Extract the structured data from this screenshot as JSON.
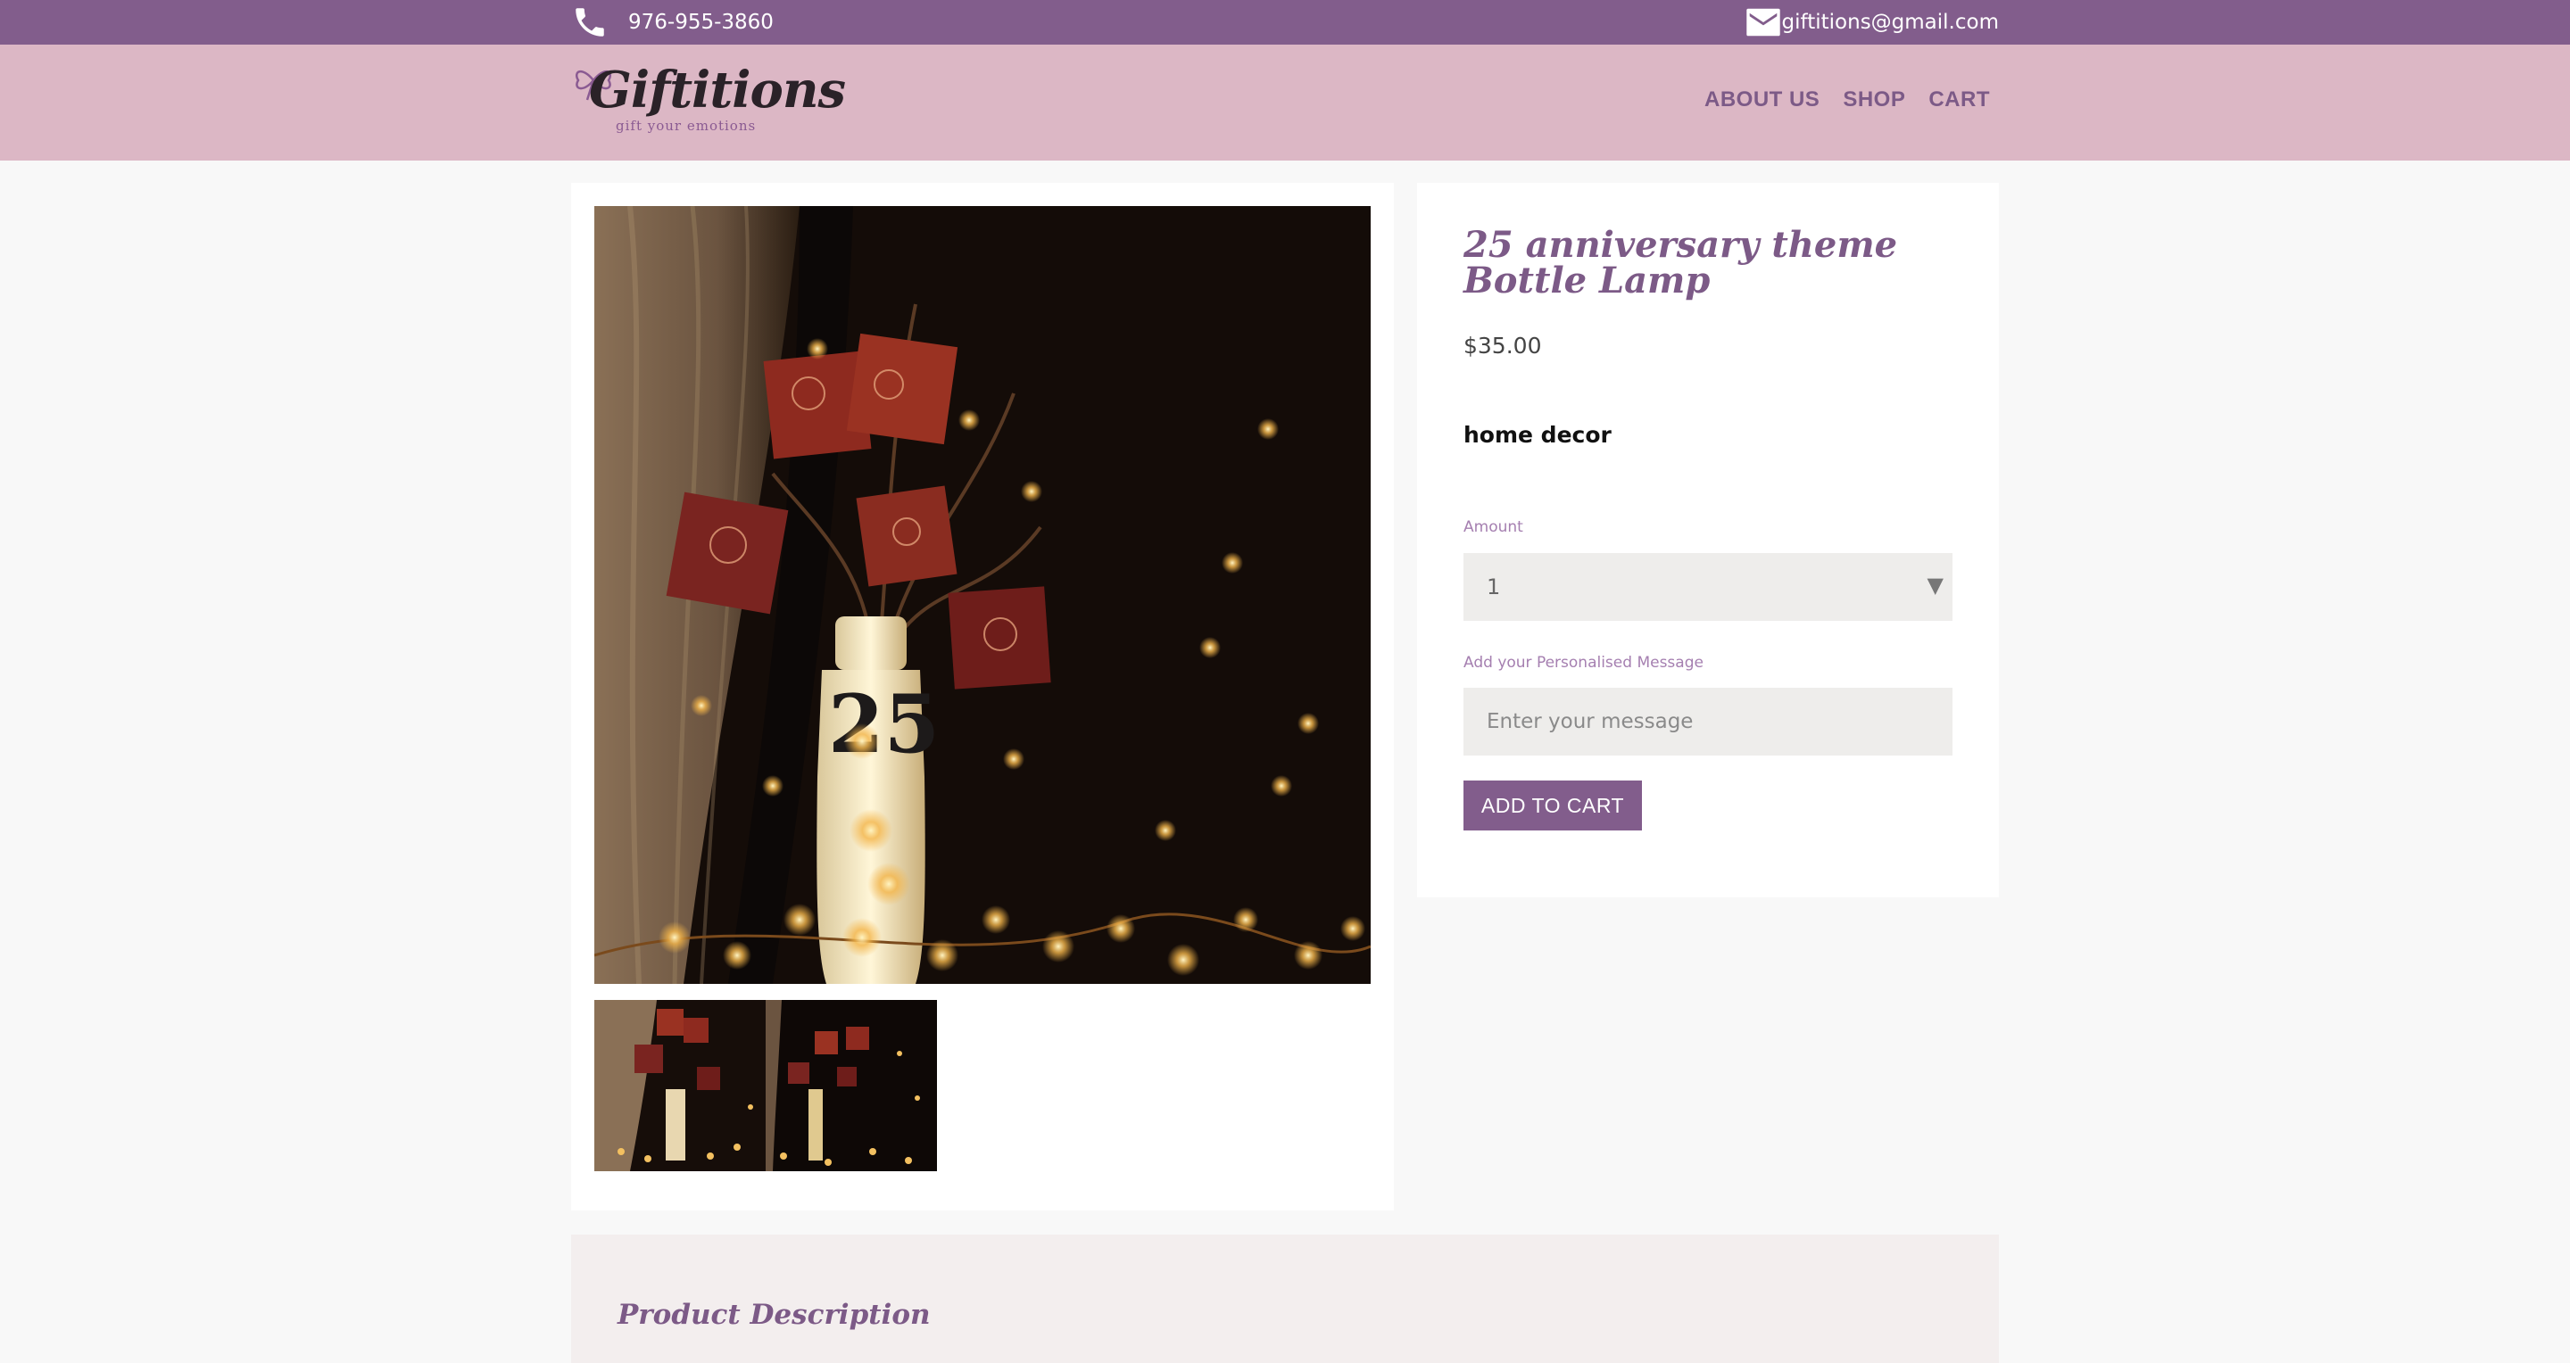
{
  "topbar": {
    "phone": "976-955-3860",
    "email": "giftitions@gmail.com",
    "phone_icon": "phone-icon",
    "email_icon": "envelope-icon"
  },
  "header": {
    "logo_text": "Giftitions",
    "logo_tagline": "gift your emotions",
    "nav": [
      "ABOUT US",
      "SHOP",
      "CART"
    ]
  },
  "product": {
    "title": "25 anniversary theme Bottle Lamp",
    "price": "$35.00",
    "category": "home decor",
    "amount_label": "Amount",
    "amount_value": "1",
    "message_label": "Add your Personalised Message",
    "message_placeholder": "Enter your message",
    "add_to_cart": "ADD TO CART"
  },
  "description": {
    "title": "Product Description"
  },
  "colors": {
    "topbar": "#825d8c",
    "header": "#dcb7c5",
    "accent": "#7c5a87",
    "field_bg": "#eeedeb"
  }
}
